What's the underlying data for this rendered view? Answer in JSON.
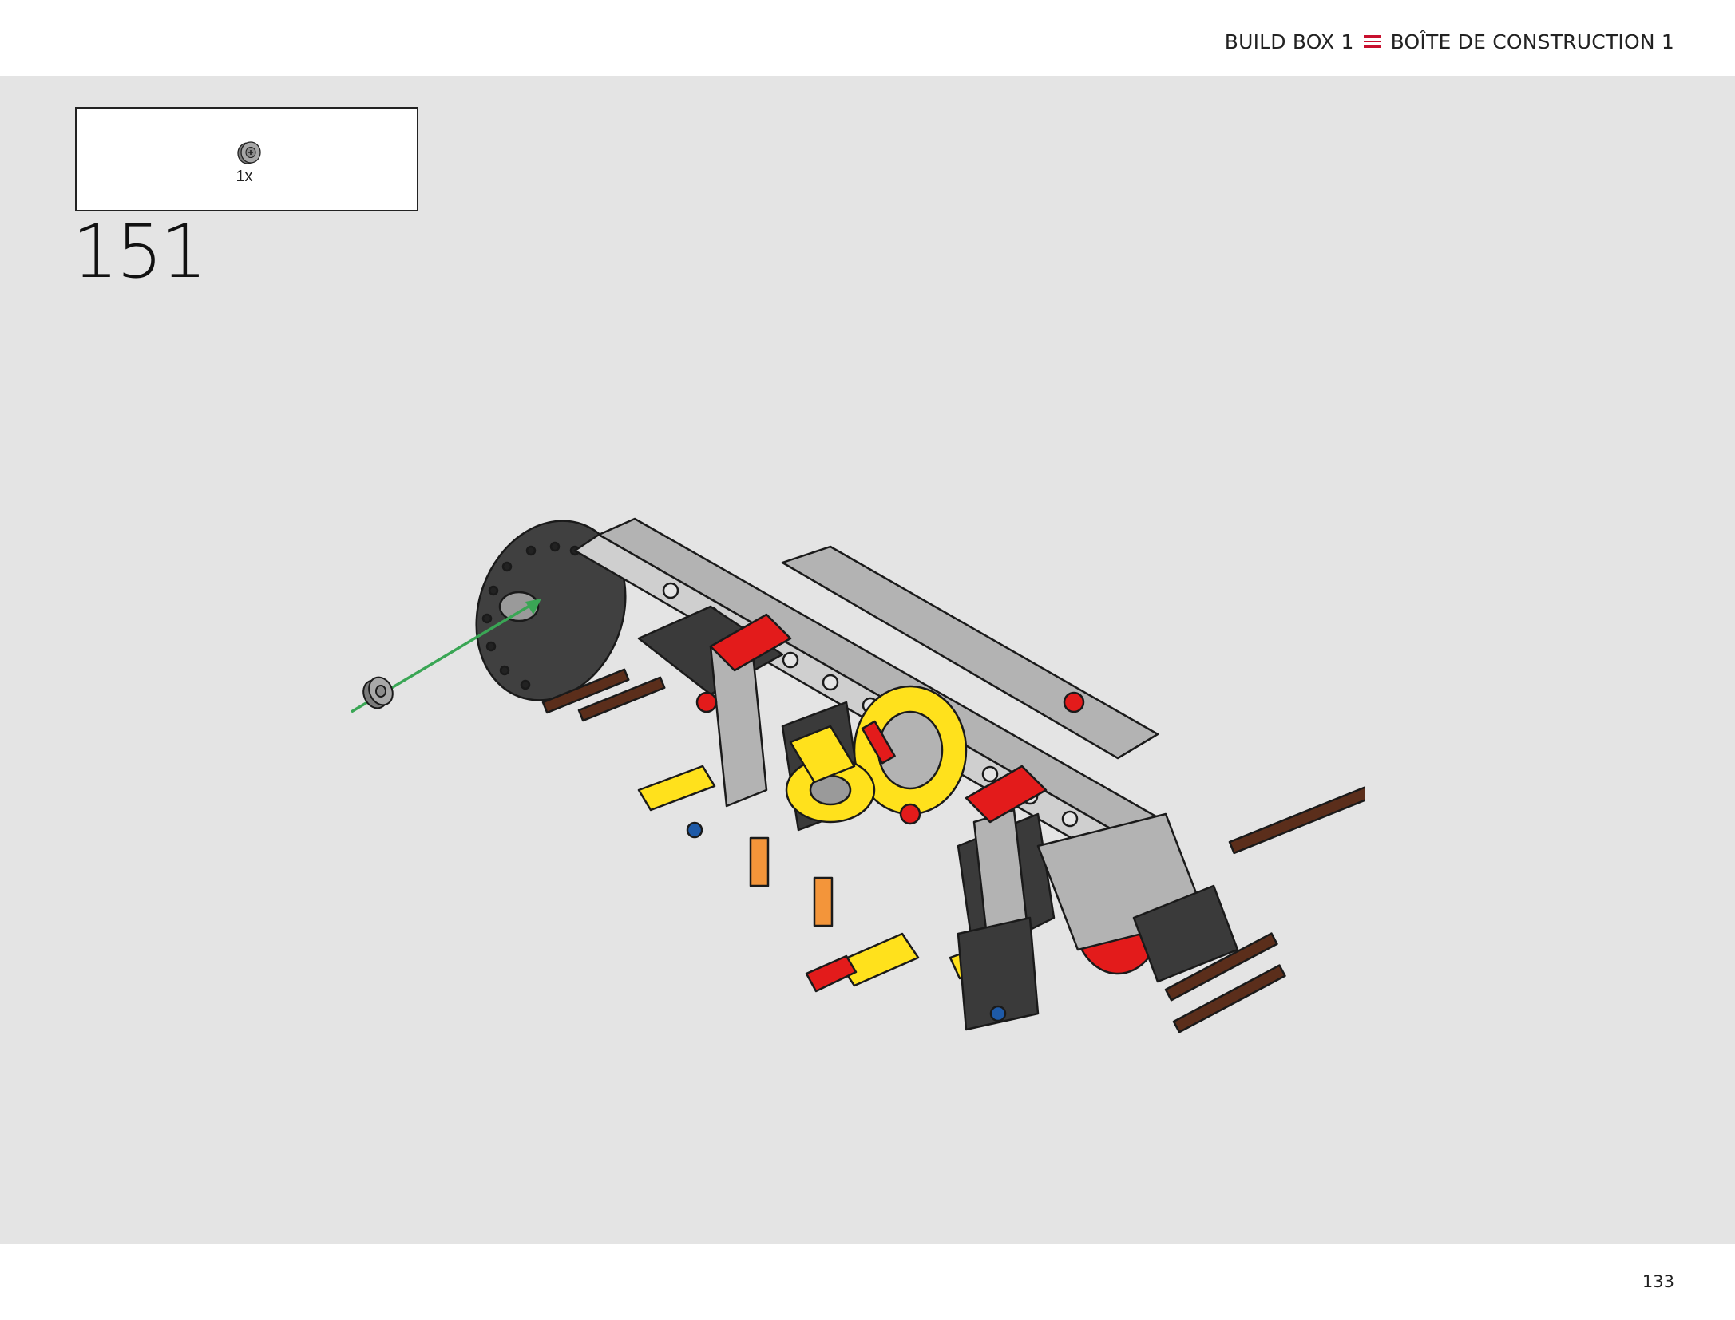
{
  "header": {
    "title_en": "BUILD BOX 1",
    "title_fr": "BOÎTE DE CONSTRUCTION 1",
    "separator_icon": "menu-lines-icon",
    "accent_color": "#c8102e"
  },
  "parts_callout": {
    "items": [
      {
        "part_icon": "bush-connector-icon",
        "quantity": "1x",
        "color": "#9b9b9b"
      }
    ]
  },
  "step": {
    "number": "151"
  },
  "illustration": {
    "subject": "lego-technic-chassis-assembly",
    "arrow_color": "#3aa655",
    "part_colors": {
      "light_grey": "#b3b3b3",
      "dark_grey": "#3a3a3a",
      "red": "#e31b1b",
      "yellow": "#ffe11c",
      "brown": "#5b2e1b",
      "orange": "#f3953a",
      "blue": "#1e5aa8"
    }
  },
  "footer": {
    "page_number": "133"
  }
}
